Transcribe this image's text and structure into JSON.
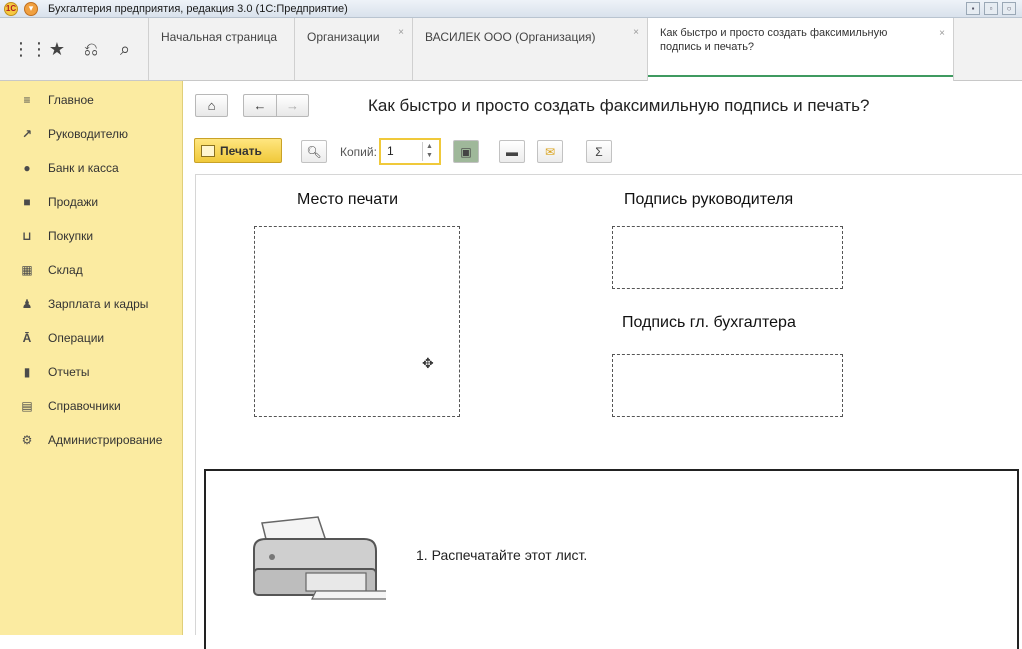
{
  "window": {
    "title": "Бухгалтерия предприятия, редакция 3.0  (1С:Предприятие)"
  },
  "tabs": [
    {
      "label": "Начальная страница",
      "closable": false
    },
    {
      "label": "Организации",
      "closable": true
    },
    {
      "label": "ВАСИЛЕК ООО (Организация)",
      "closable": true
    },
    {
      "label_line1": "Как быстро и просто создать факсимильную",
      "label_line2": "подпись и печать?",
      "closable": true,
      "active": true
    }
  ],
  "sidebar": {
    "items": [
      {
        "label": "Главное",
        "icon": "list-icon"
      },
      {
        "label": "Руководителю",
        "icon": "trend-icon"
      },
      {
        "label": "Банк и касса",
        "icon": "coin-icon"
      },
      {
        "label": "Продажи",
        "icon": "bag-icon"
      },
      {
        "label": "Покупки",
        "icon": "cart-icon"
      },
      {
        "label": "Склад",
        "icon": "warehouse-icon"
      },
      {
        "label": "Зарплата и кадры",
        "icon": "person-icon"
      },
      {
        "label": "Операции",
        "icon": "operations-icon"
      },
      {
        "label": "Отчеты",
        "icon": "bar-chart-icon"
      },
      {
        "label": "Справочники",
        "icon": "books-icon"
      },
      {
        "label": "Администрирование",
        "icon": "gear-icon"
      }
    ]
  },
  "content": {
    "page_title": "Как быстро и просто создать факсимильную подпись и печать?",
    "toolbar": {
      "print_label": "Печать",
      "copies_label": "Копий:",
      "copies_value": "1",
      "sum_symbol": "Σ"
    },
    "document": {
      "stamp_label": "Место печати",
      "director_signature_label": "Подпись руководителя",
      "accountant_signature_label": "Подпись гл. бухгалтера",
      "step1": "1. Распечатайте этот лист."
    }
  },
  "colors": {
    "sidebar_bg": "#fbeba1",
    "accent_yellow": "#f0c93a",
    "active_tab_underline": "#3f9a60"
  }
}
